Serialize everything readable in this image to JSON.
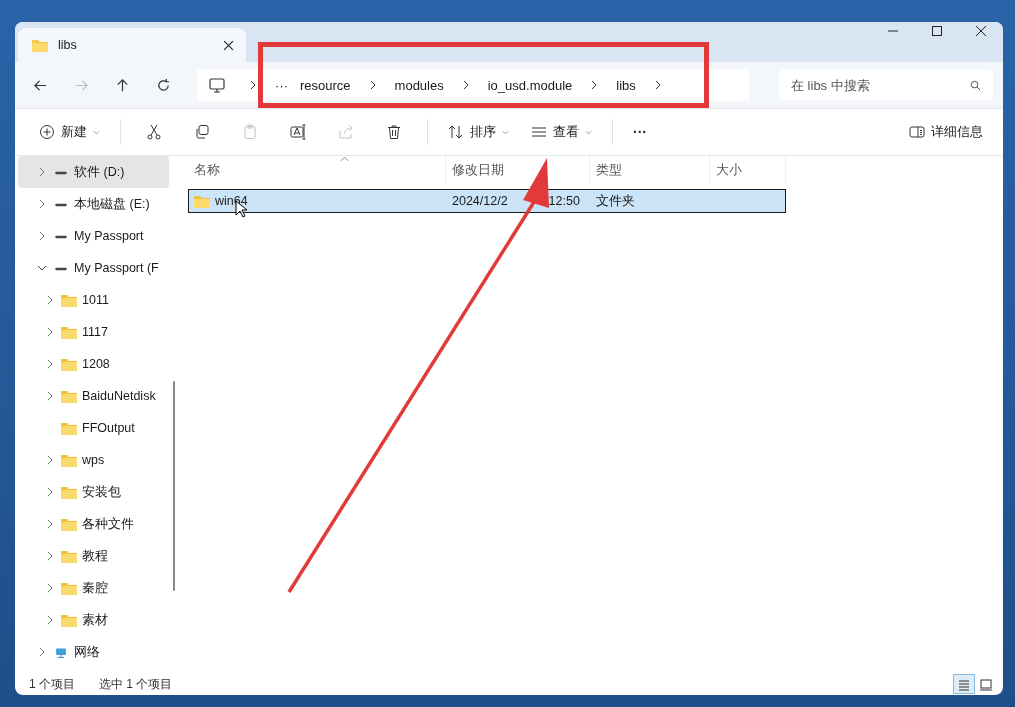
{
  "window": {
    "tab_title": "libs"
  },
  "nav": {
    "back": {
      "disabled": false
    },
    "forward": {
      "disabled": true
    }
  },
  "breadcrumb": {
    "overflow": "···",
    "items": [
      "resource",
      "modules",
      "io_usd.module",
      "libs"
    ]
  },
  "search": {
    "placeholder": "在 libs 中搜索"
  },
  "toolbar": {
    "new_label": "新建",
    "tools": [
      {
        "kind": "cut",
        "disabled": false
      },
      {
        "kind": "copy",
        "disabled": false
      },
      {
        "kind": "paste",
        "disabled": true
      },
      {
        "kind": "rename",
        "disabled": false
      },
      {
        "kind": "share",
        "disabled": true
      },
      {
        "kind": "delete",
        "disabled": false
      }
    ],
    "sort_label": "排序",
    "view_label": "查看",
    "more": "···",
    "details_label": "详细信息"
  },
  "sidebar": {
    "items": [
      {
        "kind": "drive",
        "label": "软件 (D:)",
        "expanded": false,
        "selected": true
      },
      {
        "kind": "drive",
        "label": "本地磁盘 (E:)",
        "expanded": false,
        "selected": false
      },
      {
        "kind": "drive",
        "label": "My Passport",
        "expanded": false,
        "selected": false
      },
      {
        "kind": "drive",
        "label": "My Passport (F",
        "expanded": true,
        "selected": false,
        "children": [
          {
            "kind": "folder",
            "label": "1011",
            "expanded": false,
            "selected": false
          },
          {
            "kind": "folder",
            "label": "1117",
            "expanded": false,
            "selected": false
          },
          {
            "kind": "folder",
            "label": "1208",
            "expanded": false,
            "selected": false
          },
          {
            "kind": "folder",
            "label": "BaiduNetdisk",
            "expanded": false,
            "selected": false
          },
          {
            "kind": "folder",
            "label": "FFOutput",
            "selected": false
          },
          {
            "kind": "folder",
            "label": "wps",
            "expanded": false,
            "selected": false
          },
          {
            "kind": "folder",
            "label": "安装包",
            "expanded": false,
            "selected": false
          },
          {
            "kind": "folder",
            "label": "各种文件",
            "expanded": false,
            "selected": false
          },
          {
            "kind": "folder",
            "label": "教程",
            "expanded": false,
            "selected": false
          },
          {
            "kind": "folder",
            "label": "秦腔",
            "expanded": false,
            "selected": false
          },
          {
            "kind": "folder",
            "label": "素材",
            "expanded": false,
            "selected": false
          }
        ]
      },
      {
        "kind": "network",
        "label": "网络",
        "expanded": false,
        "selected": false
      }
    ]
  },
  "table": {
    "columns": [
      "名称",
      "修改日期",
      "类型",
      "大小"
    ],
    "rows": [
      {
        "name": "win64",
        "date": "2024/12/2",
        "time": "12:50",
        "type": "文件夹",
        "size": "",
        "selected": true
      }
    ]
  },
  "status_bar": {
    "count": "1 个项目",
    "selection": "选中 1 个项目",
    "views": [
      {
        "kind": "details",
        "selected": true
      },
      {
        "kind": "tiles",
        "selected": false
      }
    ]
  }
}
